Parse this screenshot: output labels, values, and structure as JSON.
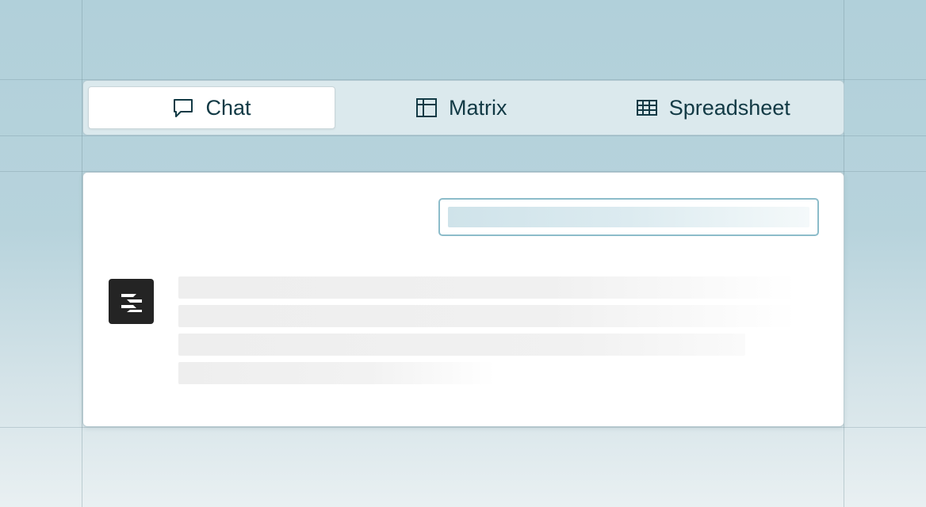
{
  "tabs": [
    {
      "label": "Chat",
      "icon": "chat-bubble-icon",
      "active": true
    },
    {
      "label": "Matrix",
      "icon": "matrix-icon",
      "active": false
    },
    {
      "label": "Spreadsheet",
      "icon": "spreadsheet-icon",
      "active": false
    }
  ],
  "card": {
    "avatar_icon": "assistant-logo-icon"
  },
  "colors": {
    "background_top": "#b1d0da",
    "background_bottom": "#e9f0f2",
    "text": "#123a45",
    "avatar_bg": "#242424",
    "query_border": "#8cbcca"
  }
}
